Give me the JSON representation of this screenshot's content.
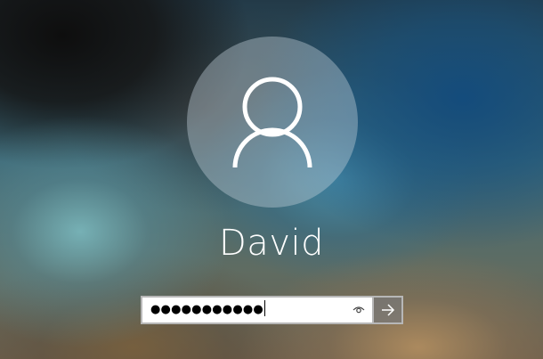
{
  "user": {
    "name": "David"
  },
  "password": {
    "masked_value": "●●●●●●●●●●●",
    "reveal_icon": "eye-icon"
  },
  "submit": {
    "icon": "arrow-right-icon"
  },
  "avatar": {
    "icon": "user-icon"
  }
}
